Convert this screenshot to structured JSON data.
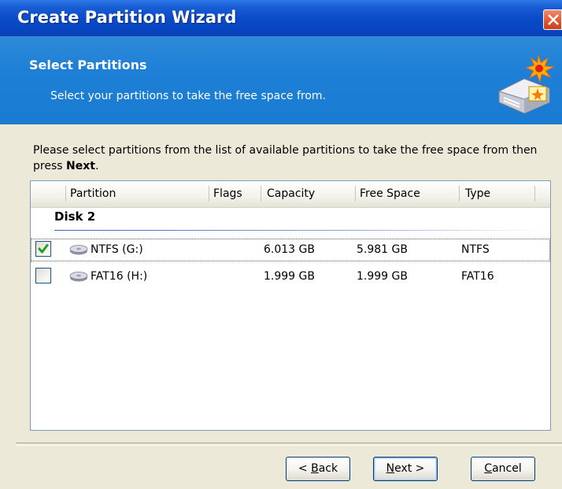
{
  "window": {
    "title": "Create Partition Wizard"
  },
  "header": {
    "title": "Select Partitions",
    "subtitle": "Select your partitions to take the free space from.",
    "icon": "wizard-disk-icon"
  },
  "instruction": {
    "text_before": "Please select partitions from the list of available partitions to take the free space from then press ",
    "bold_word": "Next",
    "text_after": "."
  },
  "list": {
    "columns": [
      "Partition",
      "Flags",
      "Capacity",
      "Free Space",
      "Type"
    ],
    "groups": [
      {
        "name": "Disk 2",
        "rows": [
          {
            "checked": true,
            "partition": "NTFS (G:)",
            "flags": "",
            "capacity": "6.013 GB",
            "free_space": "5.981 GB",
            "type": "NTFS",
            "icon": "partition-disk-icon"
          },
          {
            "checked": false,
            "partition": "FAT16 (H:)",
            "flags": "",
            "capacity": "1.999 GB",
            "free_space": "1.999 GB",
            "type": "FAT16",
            "icon": "partition-disk-icon"
          }
        ]
      }
    ]
  },
  "buttons": {
    "back_prefix": "< ",
    "back_mnemonic": "B",
    "back_rest": "ack",
    "next_mnemonic": "N",
    "next_rest": "ext >",
    "cancel_mnemonic": "C",
    "cancel_rest": "ancel"
  },
  "colors": {
    "title_bar": "#0a4bc8",
    "header_band": "#1d7fd6",
    "dialog_bg": "#ece9d8",
    "check_green": "#21a121",
    "close_red": "#e2542c"
  }
}
